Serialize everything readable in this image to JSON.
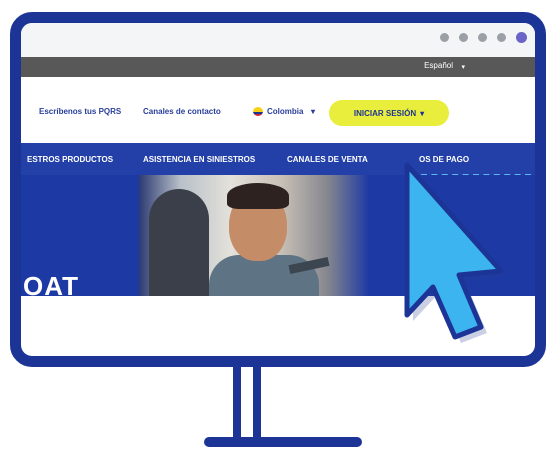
{
  "lang_bar": {
    "language": "Español"
  },
  "nav_top": {
    "pqrs": "Escríbenos tus PQRS",
    "contact": "Canales de contacto",
    "country": "Colombia",
    "login": "INICIAR SESIÓN"
  },
  "menu": {
    "products": "ESTROS PRODUCTOS",
    "claims": "ASISTENCIA EN SINIESTROS",
    "sales": "CANALES DE VENTA",
    "payment": "OS DE PAGO"
  },
  "hero": {
    "title": "OAT"
  },
  "icons": {
    "caret": "▾",
    "cursor": "pointer-cursor-icon"
  },
  "colors": {
    "brand_blue": "#1c3496",
    "menu_blue": "#2340a8",
    "login_yellow": "#e8ee3b",
    "cursor_blue": "#3cb4ef"
  }
}
